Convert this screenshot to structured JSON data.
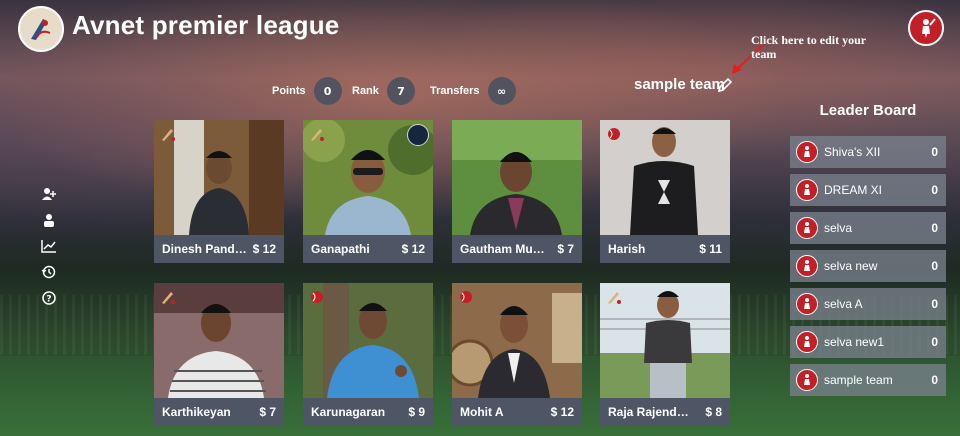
{
  "header": {
    "title": "Avnet premier league"
  },
  "stats": [
    {
      "label": "Points",
      "value": "0"
    },
    {
      "label": "Rank",
      "value": "7"
    },
    {
      "label": "Transfers",
      "value": "∞"
    }
  ],
  "team": {
    "name": "sample team",
    "edit_hint": "Click here to edit your team"
  },
  "side_nav": [
    "add-user-icon",
    "team-icon",
    "stats-chart-icon",
    "history-icon",
    "help-icon"
  ],
  "players": [
    {
      "name": "Dinesh Pandiy…",
      "price": "$ 12",
      "photo_bg": "#7b5b3a",
      "shirt": "#2a2d33",
      "skin": "#6b4a32"
    },
    {
      "name": "Ganapathi",
      "price": "$ 12",
      "photo_bg": "#6f8b3c",
      "shirt": "#9bb7cf",
      "skin": "#8a5c3e"
    },
    {
      "name": "Gautham Mukes…",
      "price": "$ 7",
      "photo_bg": "#5e8f3e",
      "shirt": "#2a2a2e",
      "skin": "#6a4530"
    },
    {
      "name": "Harish",
      "price": "$ 11",
      "photo_bg": "#d3cfcc",
      "shirt": "#1d1d1f",
      "skin": "#8c6045"
    },
    {
      "name": "Karthikeyan",
      "price": "$ 7",
      "photo_bg": "#8a6b6b",
      "shirt": "#e8e8e8",
      "skin": "#6b4530"
    },
    {
      "name": "Karunagaran",
      "price": "$ 9",
      "photo_bg": "#5b6d3f",
      "shirt": "#3f8fd3",
      "skin": "#6e4a35"
    },
    {
      "name": "Mohit A",
      "price": "$ 12",
      "photo_bg": "#8d6a4a",
      "shirt": "#2a2a30",
      "skin": "#7a5038"
    },
    {
      "name": "Raja Rajender…",
      "price": "$ 8",
      "photo_bg": "#d9e3e8",
      "shirt": "#3a3a3c",
      "skin": "#8a5d42"
    }
  ],
  "leaderboard": {
    "title": "Leader Board",
    "rows": [
      {
        "name": "Shiva's XII",
        "points": "0"
      },
      {
        "name": "DREAM XI",
        "points": "0"
      },
      {
        "name": "selva",
        "points": "0"
      },
      {
        "name": "selva new",
        "points": "0"
      },
      {
        "name": "selva A",
        "points": "0"
      },
      {
        "name": "selva new1",
        "points": "0"
      },
      {
        "name": "sample team",
        "points": "0"
      }
    ]
  }
}
